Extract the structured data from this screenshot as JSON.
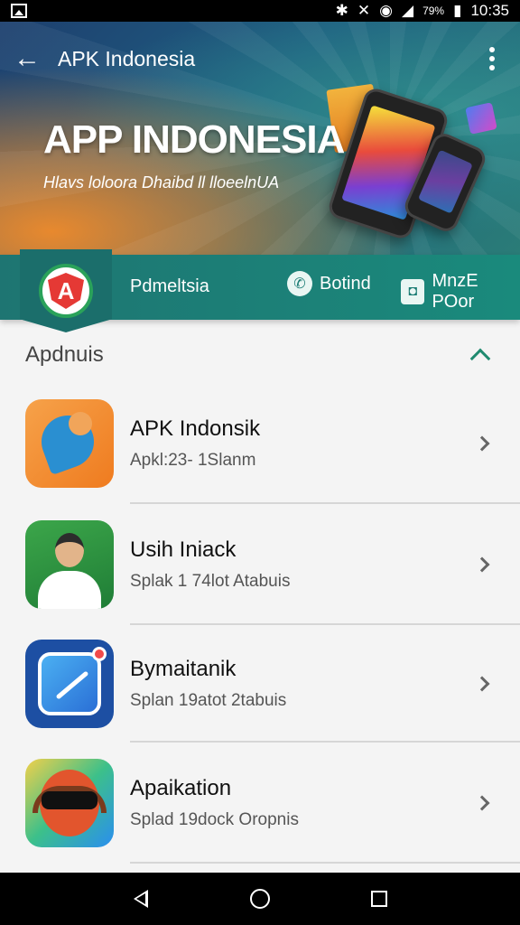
{
  "status_bar": {
    "battery_percent": "79%",
    "time": "10:35",
    "icons": [
      "gallery-icon",
      "bluetooth-icon",
      "silent-icon",
      "wifi-icon",
      "signal-icon",
      "battery-icon"
    ]
  },
  "toolbar": {
    "title": "APK Indonesia",
    "back_icon": "arrow-left-icon",
    "more_icon": "more-vert-icon"
  },
  "banner": {
    "title": "APP INDONESIA",
    "subtitle": "Hlavs loloora Dhaibd ll lloeelnUA"
  },
  "tab_strip": {
    "logo_letter": "A",
    "main_label": "Pdmeltsia",
    "items": [
      {
        "label": "Botind",
        "icon": "phone-icon"
      },
      {
        "label": "MnzE POor",
        "icon": "camera-icon"
      }
    ]
  },
  "section": {
    "title": "Apdnuis",
    "collapse_icon": "chevron-up-icon"
  },
  "apps": [
    {
      "name": "APK Indonsik",
      "subtitle": "Apkl:23- 1Slanm",
      "icon": "fox-icon"
    },
    {
      "name": "Usih Iniack",
      "subtitle": "Splak 1 74lot Atabuis",
      "icon": "person-icon"
    },
    {
      "name": "Bymaitanik",
      "subtitle": "Splan 19atot 2tabuis",
      "icon": "chart-icon"
    },
    {
      "name": "Apaikation",
      "subtitle": "Splad 19dock Oropnis",
      "icon": "headphones-face-icon"
    }
  ],
  "colors": {
    "teal_accent": "#1a7c74",
    "banner_orange": "#e8892e",
    "banner_blue": "#1d3f6e"
  }
}
